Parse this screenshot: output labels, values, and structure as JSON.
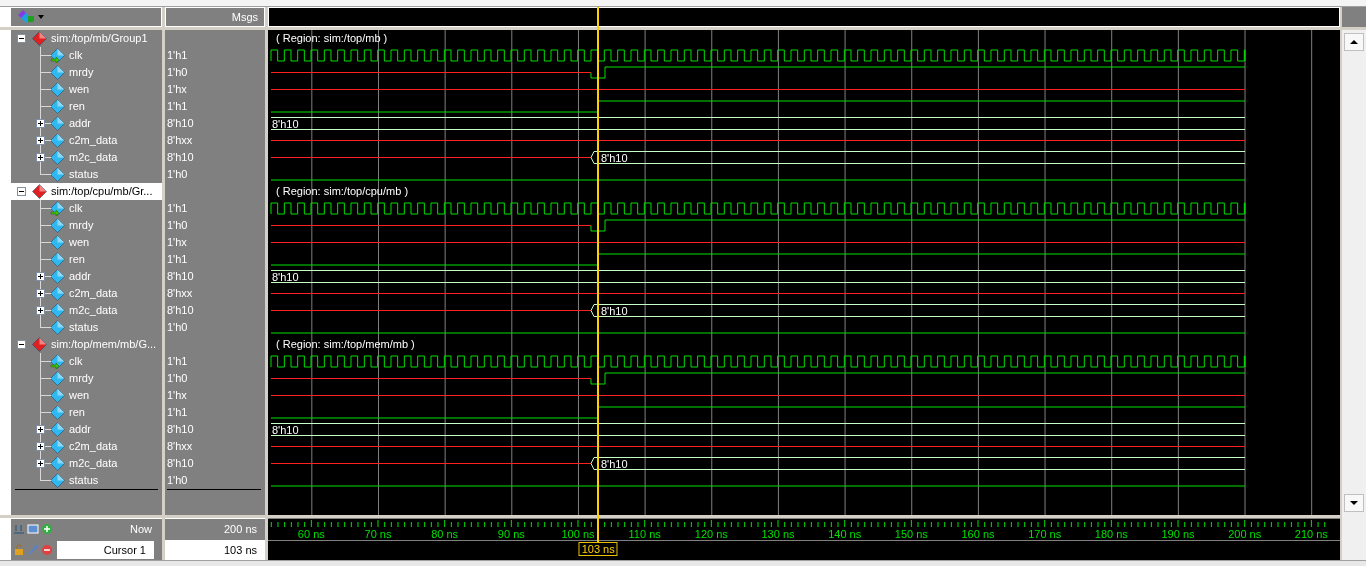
{
  "value_header": "Msgs",
  "groups": [
    {
      "path": "sim:/top/mb/Group1",
      "expanded": true,
      "selected": false,
      "region": "( Region: sim:/top/mb )",
      "signals": [
        {
          "name": "clk",
          "value": "1'h1",
          "kind": "clock"
        },
        {
          "name": "mrdy",
          "value": "1'h0",
          "kind": "x_low_high"
        },
        {
          "name": "wen",
          "value": "1'hx",
          "kind": "unknown"
        },
        {
          "name": "ren",
          "value": "1'h1",
          "kind": "low_high"
        },
        {
          "name": "addr",
          "value": "8'h10",
          "kind": "bus",
          "wave_label": "8'h10",
          "expanded": false
        },
        {
          "name": "c2m_data",
          "value": "8'hxx",
          "kind": "unknown",
          "expanded": false
        },
        {
          "name": "m2c_data",
          "value": "8'h10",
          "kind": "x_bus",
          "wave_label": "8'h10",
          "expanded": false
        },
        {
          "name": "status",
          "value": "1'h0",
          "kind": "low"
        }
      ]
    },
    {
      "path": "sim:/top/cpu/mb/Gr...",
      "expanded": true,
      "selected": true,
      "region": "( Region: sim:/top/cpu/mb )",
      "signals": [
        {
          "name": "clk",
          "value": "1'h1",
          "kind": "clock"
        },
        {
          "name": "mrdy",
          "value": "1'h0",
          "kind": "x_low_high"
        },
        {
          "name": "wen",
          "value": "1'hx",
          "kind": "unknown"
        },
        {
          "name": "ren",
          "value": "1'h1",
          "kind": "low_high"
        },
        {
          "name": "addr",
          "value": "8'h10",
          "kind": "bus",
          "wave_label": "8'h10",
          "expanded": false
        },
        {
          "name": "c2m_data",
          "value": "8'hxx",
          "kind": "unknown",
          "expanded": false
        },
        {
          "name": "m2c_data",
          "value": "8'h10",
          "kind": "x_bus",
          "wave_label": "8'h10",
          "expanded": false
        },
        {
          "name": "status",
          "value": "1'h0",
          "kind": "low"
        }
      ]
    },
    {
      "path": "sim:/top/mem/mb/G...",
      "expanded": true,
      "selected": false,
      "region": "( Region: sim:/top/mem/mb )",
      "signals": [
        {
          "name": "clk",
          "value": "1'h1",
          "kind": "clock"
        },
        {
          "name": "mrdy",
          "value": "1'h0",
          "kind": "x_low_high"
        },
        {
          "name": "wen",
          "value": "1'hx",
          "kind": "unknown"
        },
        {
          "name": "ren",
          "value": "1'h1",
          "kind": "low_high"
        },
        {
          "name": "addr",
          "value": "8'h10",
          "kind": "bus",
          "wave_label": "8'h10",
          "expanded": false
        },
        {
          "name": "c2m_data",
          "value": "8'hxx",
          "kind": "unknown",
          "expanded": false
        },
        {
          "name": "m2c_data",
          "value": "8'h10",
          "kind": "x_bus",
          "wave_label": "8'h10",
          "expanded": false
        },
        {
          "name": "status",
          "value": "1'h0",
          "kind": "low"
        }
      ]
    }
  ],
  "now": {
    "label": "Now",
    "time": "200 ns"
  },
  "cursor": {
    "label": "Cursor 1",
    "time": "103 ns",
    "marker": "103 ns",
    "level": 0.308
  },
  "timeline": [
    "60 ns",
    "70 ns",
    "80 ns",
    "90 ns",
    "100 ns",
    "110 ns",
    "120 ns",
    "130 ns",
    "140 ns",
    "150 ns",
    "160 ns",
    "170 ns",
    "180 ns",
    "190 ns",
    "200 ns",
    "210 ns"
  ]
}
